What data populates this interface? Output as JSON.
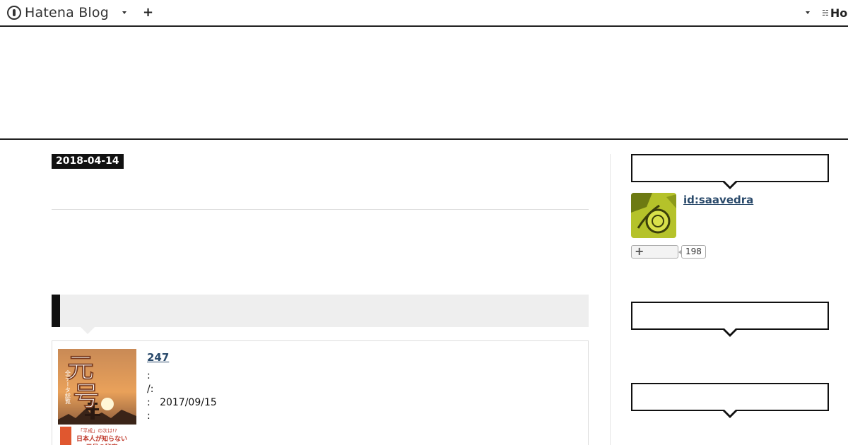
{
  "globalbar": {
    "brand": "Hatena Blog",
    "add_label": "+",
    "right_logo": "Ho"
  },
  "entry": {
    "date": "2018-04-14"
  },
  "product": {
    "title": " 247 ",
    "meta": [
      ":",
      "/:",
      ":   2017/09/15",
      ":"
    ],
    "cover_title": "元号",
    "cover_sub": "全データ総覧",
    "cover_band": "「平成」の次は!? 日本人が知らない 元号の秘密"
  },
  "sidebar": {
    "user_id": "id:saavedra",
    "subscribe_icon": "+",
    "subscriber_count": "198"
  },
  "colors": {
    "accent": "#111111",
    "link": "#2a4a6b",
    "heading_bg": "#eeeeee"
  }
}
